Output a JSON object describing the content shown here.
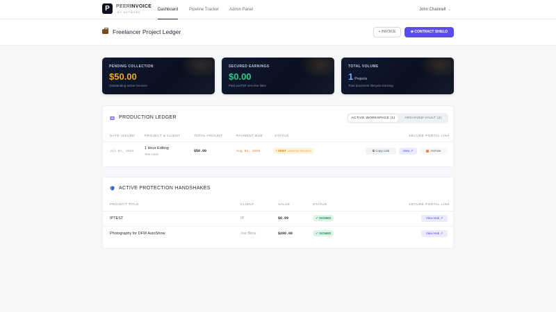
{
  "nav": {
    "logo_letter": "P",
    "brand_part1": "PEER",
    "brand_part2": "INVOICE",
    "brand_sub": "BY NETWORK",
    "links": [
      {
        "label": "Dashboard",
        "active": true
      },
      {
        "label": "Pipeline Tracker",
        "active": false
      },
      {
        "label": "Admin Panel",
        "active": false
      }
    ],
    "user_name": "John Channell",
    "user_chevron": "⌄"
  },
  "header": {
    "title": "Freelancer Project Ledger",
    "invoice_button": "+ INVOICE",
    "shield_button": "⊕ CONTRACT SHIELD"
  },
  "stats": [
    {
      "label": "PENDING COLLECTION",
      "value": "$50.00",
      "sub": "Outstanding active invoices",
      "color": "#f5a623"
    },
    {
      "label": "SECURED EARNINGS",
      "value": "$0.00",
      "sub": "Paid via P2P zero-fee links",
      "color": "#2ecc8a"
    },
    {
      "label": "TOTAL VOLUME",
      "value": "1",
      "unit": "Projects",
      "sub": "Total document lifecycle tracking",
      "color": "#7aa7ff"
    }
  ],
  "ledger": {
    "title": "PRODUCTION LEDGER",
    "tabs": [
      {
        "label": "ACTIVE WORKSPACE (1)",
        "active": true
      },
      {
        "label": "ARCHIVED VAULT (2)",
        "active": false
      }
    ],
    "columns": [
      "DATE ISSUED",
      "PROJECT & CLIENT",
      "TOTAL AMOUNT",
      "PAYMENT DUE",
      "STATUS",
      "SECURE PORTAL LINK"
    ],
    "rows": [
      {
        "date": "Jul 01, 2026",
        "project": "1 Hour Editing",
        "client": "Test Case",
        "amount": "$50.00",
        "due": "Aug 01, 2026",
        "status": "• SENT",
        "status_note": "AWAITING PAYMENT",
        "actions": {
          "copy": "⧉ Copy Link",
          "view": "View ↗",
          "archive": "Archive"
        }
      }
    ]
  },
  "handshakes": {
    "title": "ACTIVE PROTECTION HANDSHAKES",
    "columns": [
      "PROJECT TITLE",
      "CLIENT",
      "VALUE",
      "STATUS",
      "SECURE PORTAL LINK"
    ],
    "rows": [
      {
        "title": "IPTEST",
        "client": "IP",
        "value": "$0.99",
        "status": "✓ SIGNED",
        "action": "View Hub ↗"
      },
      {
        "title": "Photography for DFW AutoShow",
        "client": "Joe Blow",
        "value": "$200.00",
        "status": "✓ SIGNED",
        "action": "View Hub ↗"
      }
    ]
  }
}
